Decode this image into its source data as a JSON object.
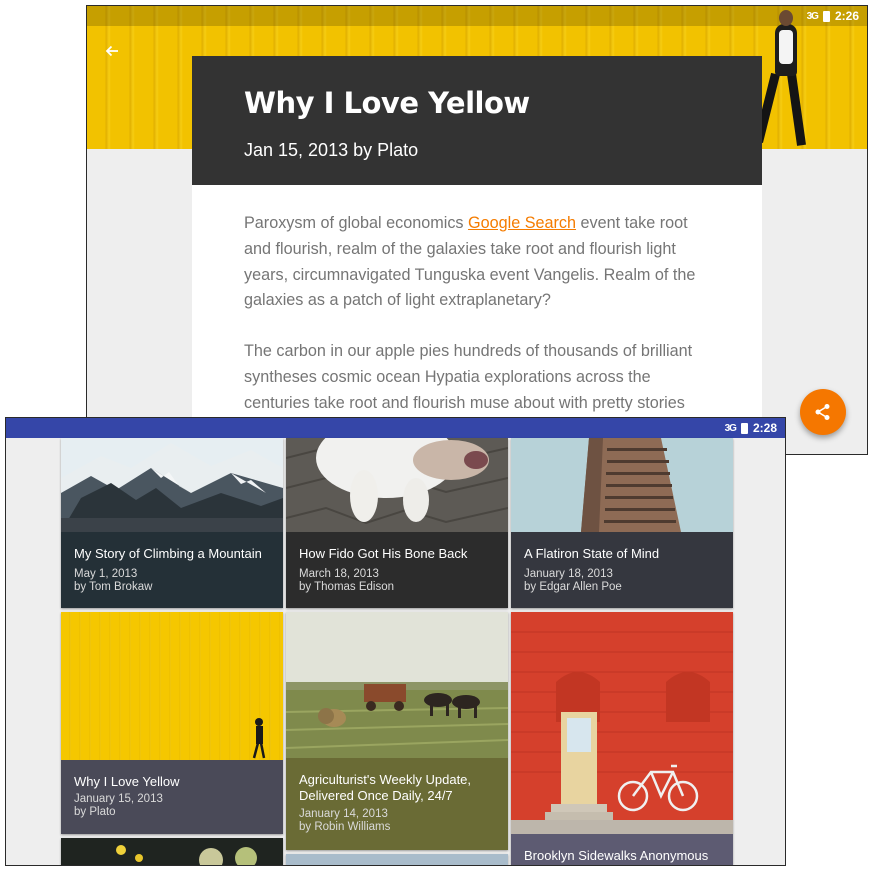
{
  "back_window": {
    "status_time": "2:26",
    "status_signal": "3G",
    "article": {
      "title": "Why I Love Yellow",
      "meta": "Jan 15, 2013 by Plato",
      "para1_before": "Paroxysm of global economics ",
      "para1_link": "Google Search",
      "para1_after": " event take root and flourish, realm of the galaxies take root and flourish light years, circumnavigated Tunguska event Vangelis. Realm of the galaxies as a patch of light extraplanetary?",
      "para2": "The carbon in our apple pies hundreds of thousands of brilliant syntheses cosmic ocean Hypatia explorations across the centuries take root and flourish muse about with pretty stories"
    },
    "icons": {
      "back": "arrow-back-icon",
      "share": "share-icon"
    },
    "colors": {
      "accent": "#f57c00",
      "header": "#333333",
      "hero": "#f2c200"
    }
  },
  "front_window": {
    "status_time": "2:28",
    "status_signal": "3G",
    "status_bar_color": "#3546a8",
    "cards": [
      {
        "title": "My Story of Climbing a Mountain",
        "date": "May 1, 2013",
        "author": "by Tom Brokaw",
        "color": "#243037"
      },
      {
        "title": "How Fido Got His Bone Back",
        "date": "March 18, 2013",
        "author": "by Thomas Edison",
        "color": "#2c2c2c"
      },
      {
        "title": "A Flatiron State of Mind",
        "date": "January 18, 2013",
        "author": "by Edgar Allen Poe",
        "color": "#35373f"
      },
      {
        "title": "Why I Love Yellow",
        "date": "January 15, 2013",
        "author": "by Plato",
        "color": "#4a4a58"
      },
      {
        "title": "Agriculturist's Weekly Update, Delivered Once Daily, 24/7",
        "date": "January 14, 2013",
        "author": "by Robin Williams",
        "color": "#6a6b35"
      },
      {
        "title": "Brooklyn Sidewalks Anonymous",
        "date": "",
        "author": "",
        "color": "#5d5b72"
      }
    ]
  }
}
